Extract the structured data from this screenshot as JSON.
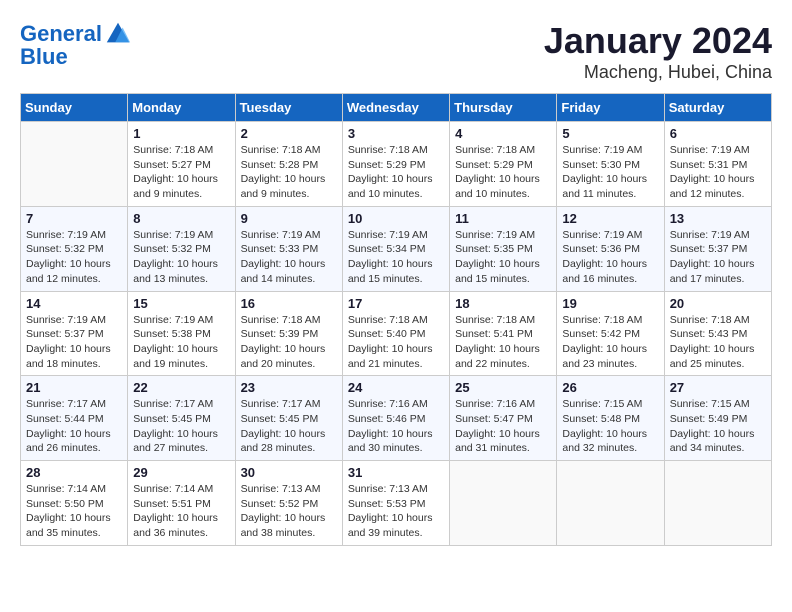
{
  "header": {
    "logo_line1": "General",
    "logo_line2": "Blue",
    "month": "January 2024",
    "location": "Macheng, Hubei, China"
  },
  "weekdays": [
    "Sunday",
    "Monday",
    "Tuesday",
    "Wednesday",
    "Thursday",
    "Friday",
    "Saturday"
  ],
  "weeks": [
    [
      {
        "day": "",
        "info": ""
      },
      {
        "day": "1",
        "info": "Sunrise: 7:18 AM\nSunset: 5:27 PM\nDaylight: 10 hours\nand 9 minutes."
      },
      {
        "day": "2",
        "info": "Sunrise: 7:18 AM\nSunset: 5:28 PM\nDaylight: 10 hours\nand 9 minutes."
      },
      {
        "day": "3",
        "info": "Sunrise: 7:18 AM\nSunset: 5:29 PM\nDaylight: 10 hours\nand 10 minutes."
      },
      {
        "day": "4",
        "info": "Sunrise: 7:18 AM\nSunset: 5:29 PM\nDaylight: 10 hours\nand 10 minutes."
      },
      {
        "day": "5",
        "info": "Sunrise: 7:19 AM\nSunset: 5:30 PM\nDaylight: 10 hours\nand 11 minutes."
      },
      {
        "day": "6",
        "info": "Sunrise: 7:19 AM\nSunset: 5:31 PM\nDaylight: 10 hours\nand 12 minutes."
      }
    ],
    [
      {
        "day": "7",
        "info": "Sunrise: 7:19 AM\nSunset: 5:32 PM\nDaylight: 10 hours\nand 12 minutes."
      },
      {
        "day": "8",
        "info": "Sunrise: 7:19 AM\nSunset: 5:32 PM\nDaylight: 10 hours\nand 13 minutes."
      },
      {
        "day": "9",
        "info": "Sunrise: 7:19 AM\nSunset: 5:33 PM\nDaylight: 10 hours\nand 14 minutes."
      },
      {
        "day": "10",
        "info": "Sunrise: 7:19 AM\nSunset: 5:34 PM\nDaylight: 10 hours\nand 15 minutes."
      },
      {
        "day": "11",
        "info": "Sunrise: 7:19 AM\nSunset: 5:35 PM\nDaylight: 10 hours\nand 15 minutes."
      },
      {
        "day": "12",
        "info": "Sunrise: 7:19 AM\nSunset: 5:36 PM\nDaylight: 10 hours\nand 16 minutes."
      },
      {
        "day": "13",
        "info": "Sunrise: 7:19 AM\nSunset: 5:37 PM\nDaylight: 10 hours\nand 17 minutes."
      }
    ],
    [
      {
        "day": "14",
        "info": "Sunrise: 7:19 AM\nSunset: 5:37 PM\nDaylight: 10 hours\nand 18 minutes."
      },
      {
        "day": "15",
        "info": "Sunrise: 7:19 AM\nSunset: 5:38 PM\nDaylight: 10 hours\nand 19 minutes."
      },
      {
        "day": "16",
        "info": "Sunrise: 7:18 AM\nSunset: 5:39 PM\nDaylight: 10 hours\nand 20 minutes."
      },
      {
        "day": "17",
        "info": "Sunrise: 7:18 AM\nSunset: 5:40 PM\nDaylight: 10 hours\nand 21 minutes."
      },
      {
        "day": "18",
        "info": "Sunrise: 7:18 AM\nSunset: 5:41 PM\nDaylight: 10 hours\nand 22 minutes."
      },
      {
        "day": "19",
        "info": "Sunrise: 7:18 AM\nSunset: 5:42 PM\nDaylight: 10 hours\nand 23 minutes."
      },
      {
        "day": "20",
        "info": "Sunrise: 7:18 AM\nSunset: 5:43 PM\nDaylight: 10 hours\nand 25 minutes."
      }
    ],
    [
      {
        "day": "21",
        "info": "Sunrise: 7:17 AM\nSunset: 5:44 PM\nDaylight: 10 hours\nand 26 minutes."
      },
      {
        "day": "22",
        "info": "Sunrise: 7:17 AM\nSunset: 5:45 PM\nDaylight: 10 hours\nand 27 minutes."
      },
      {
        "day": "23",
        "info": "Sunrise: 7:17 AM\nSunset: 5:45 PM\nDaylight: 10 hours\nand 28 minutes."
      },
      {
        "day": "24",
        "info": "Sunrise: 7:16 AM\nSunset: 5:46 PM\nDaylight: 10 hours\nand 30 minutes."
      },
      {
        "day": "25",
        "info": "Sunrise: 7:16 AM\nSunset: 5:47 PM\nDaylight: 10 hours\nand 31 minutes."
      },
      {
        "day": "26",
        "info": "Sunrise: 7:15 AM\nSunset: 5:48 PM\nDaylight: 10 hours\nand 32 minutes."
      },
      {
        "day": "27",
        "info": "Sunrise: 7:15 AM\nSunset: 5:49 PM\nDaylight: 10 hours\nand 34 minutes."
      }
    ],
    [
      {
        "day": "28",
        "info": "Sunrise: 7:14 AM\nSunset: 5:50 PM\nDaylight: 10 hours\nand 35 minutes."
      },
      {
        "day": "29",
        "info": "Sunrise: 7:14 AM\nSunset: 5:51 PM\nDaylight: 10 hours\nand 36 minutes."
      },
      {
        "day": "30",
        "info": "Sunrise: 7:13 AM\nSunset: 5:52 PM\nDaylight: 10 hours\nand 38 minutes."
      },
      {
        "day": "31",
        "info": "Sunrise: 7:13 AM\nSunset: 5:53 PM\nDaylight: 10 hours\nand 39 minutes."
      },
      {
        "day": "",
        "info": ""
      },
      {
        "day": "",
        "info": ""
      },
      {
        "day": "",
        "info": ""
      }
    ]
  ]
}
